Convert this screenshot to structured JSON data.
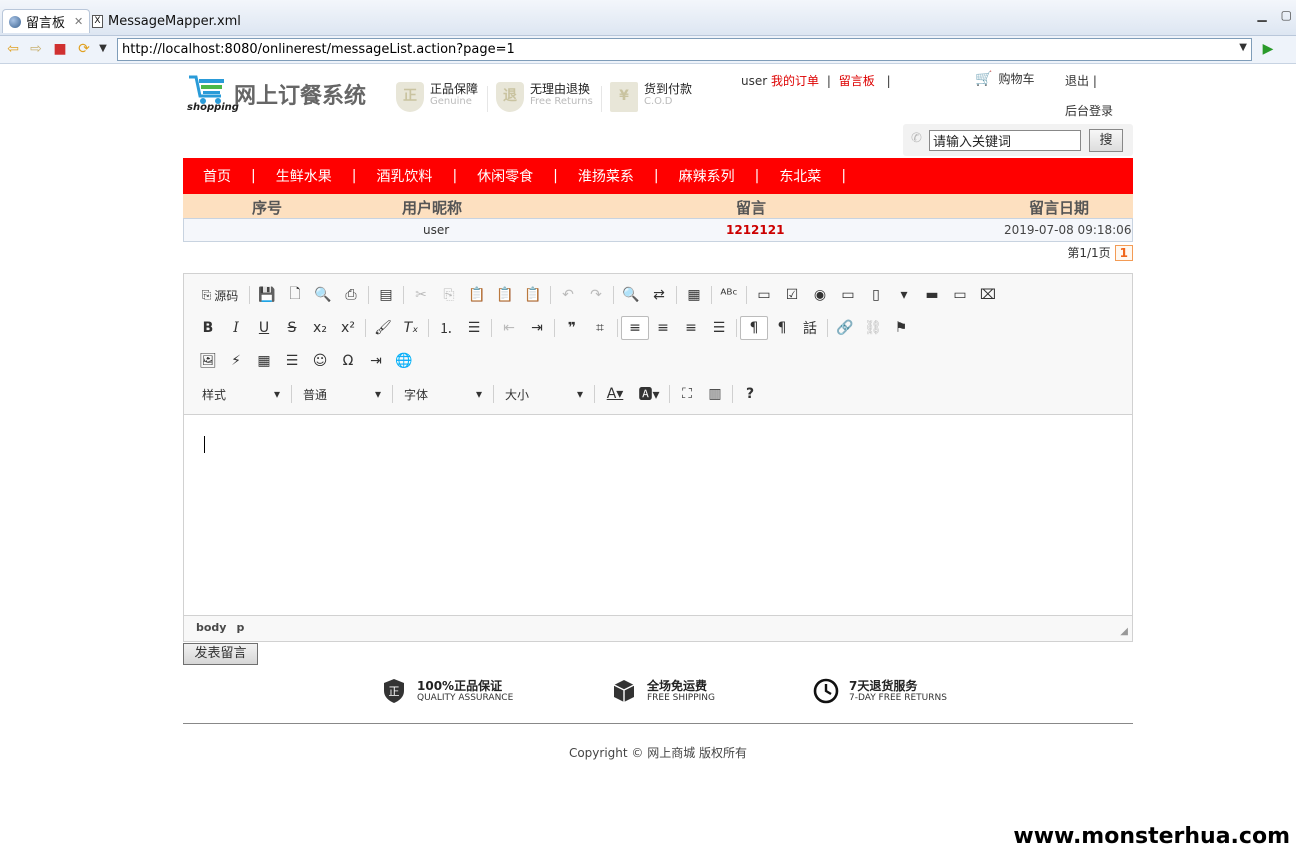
{
  "ide": {
    "tabs": [
      {
        "label": "留言板",
        "icon": "globe-icon"
      },
      {
        "label": "MessageMapper.xml",
        "icon": "xml-file-icon"
      }
    ],
    "url": "http://localhost:8080/onlinerest/messageList.action?page=1"
  },
  "header": {
    "logo_title": "网上订餐系统",
    "logo_sub": "shopping",
    "badges": [
      {
        "title": "正品保障",
        "sub": "Genuine",
        "icon": "正"
      },
      {
        "title": "无理由退换",
        "sub": "Free Returns",
        "icon": "退"
      },
      {
        "title": "货到付款",
        "sub": "C.O.D",
        "icon": "¥"
      }
    ],
    "username": "user",
    "my_orders": "我的订单",
    "message_board": "留言板",
    "cart": "购物车",
    "logout": "退出",
    "admin_login": "后台登录",
    "search_placeholder": "请输入关键词",
    "search_button": "搜"
  },
  "menu": [
    "首页",
    "生鲜水果",
    "酒乳饮料",
    "休闲零食",
    "淮扬菜系",
    "麻辣系列",
    "东北菜"
  ],
  "table": {
    "headers": [
      "序号",
      "用户昵称",
      "留言",
      "留言日期"
    ],
    "rows": [
      {
        "index": "",
        "user": "user",
        "message": "1212121",
        "date": "2019-07-08 09:18:06"
      }
    ]
  },
  "pager": {
    "text": "第1/1页",
    "current": "1"
  },
  "editor": {
    "source_label": "源码",
    "combos": [
      "样式",
      "普通",
      "字体",
      "大小"
    ],
    "path": [
      "body",
      "p"
    ],
    "submit": "发表留言"
  },
  "footer": {
    "features": [
      {
        "title": "100%正品保证",
        "sub": "QUALITY ASSURANCE",
        "icon": "shield-icon"
      },
      {
        "title": "全场免运费",
        "sub": "FREE SHIPPING",
        "icon": "box-icon"
      },
      {
        "title": "7天退货服务",
        "sub": "7-DAY FREE RETURNS",
        "icon": "clock-icon"
      }
    ],
    "copyright": "Copyright © 网上商城 版权所有"
  },
  "watermark": "www.monsterhua.com"
}
